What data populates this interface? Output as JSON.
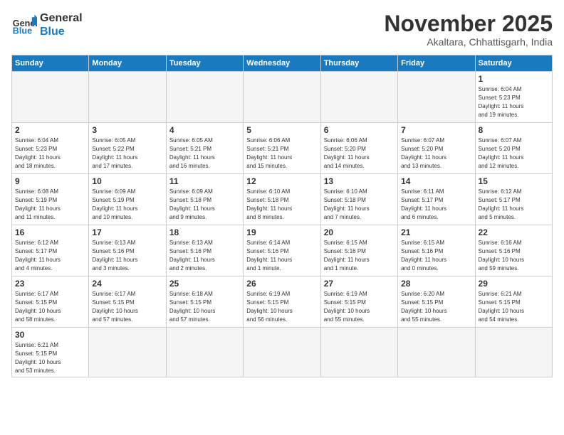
{
  "logo": {
    "text_general": "General",
    "text_blue": "Blue"
  },
  "title": "November 2025",
  "subtitle": "Akaltara, Chhattisgarh, India",
  "days_of_week": [
    "Sunday",
    "Monday",
    "Tuesday",
    "Wednesday",
    "Thursday",
    "Friday",
    "Saturday"
  ],
  "weeks": [
    [
      {
        "day": "",
        "info": ""
      },
      {
        "day": "",
        "info": ""
      },
      {
        "day": "",
        "info": ""
      },
      {
        "day": "",
        "info": ""
      },
      {
        "day": "",
        "info": ""
      },
      {
        "day": "",
        "info": ""
      },
      {
        "day": "1",
        "info": "Sunrise: 6:04 AM\nSunset: 5:23 PM\nDaylight: 11 hours\nand 19 minutes."
      }
    ],
    [
      {
        "day": "2",
        "info": "Sunrise: 6:04 AM\nSunset: 5:23 PM\nDaylight: 11 hours\nand 18 minutes."
      },
      {
        "day": "3",
        "info": "Sunrise: 6:05 AM\nSunset: 5:22 PM\nDaylight: 11 hours\nand 17 minutes."
      },
      {
        "day": "4",
        "info": "Sunrise: 6:05 AM\nSunset: 5:21 PM\nDaylight: 11 hours\nand 16 minutes."
      },
      {
        "day": "5",
        "info": "Sunrise: 6:06 AM\nSunset: 5:21 PM\nDaylight: 11 hours\nand 15 minutes."
      },
      {
        "day": "6",
        "info": "Sunrise: 6:06 AM\nSunset: 5:20 PM\nDaylight: 11 hours\nand 14 minutes."
      },
      {
        "day": "7",
        "info": "Sunrise: 6:07 AM\nSunset: 5:20 PM\nDaylight: 11 hours\nand 13 minutes."
      },
      {
        "day": "8",
        "info": "Sunrise: 6:07 AM\nSunset: 5:20 PM\nDaylight: 11 hours\nand 12 minutes."
      }
    ],
    [
      {
        "day": "9",
        "info": "Sunrise: 6:08 AM\nSunset: 5:19 PM\nDaylight: 11 hours\nand 11 minutes."
      },
      {
        "day": "10",
        "info": "Sunrise: 6:09 AM\nSunset: 5:19 PM\nDaylight: 11 hours\nand 10 minutes."
      },
      {
        "day": "11",
        "info": "Sunrise: 6:09 AM\nSunset: 5:18 PM\nDaylight: 11 hours\nand 9 minutes."
      },
      {
        "day": "12",
        "info": "Sunrise: 6:10 AM\nSunset: 5:18 PM\nDaylight: 11 hours\nand 8 minutes."
      },
      {
        "day": "13",
        "info": "Sunrise: 6:10 AM\nSunset: 5:18 PM\nDaylight: 11 hours\nand 7 minutes."
      },
      {
        "day": "14",
        "info": "Sunrise: 6:11 AM\nSunset: 5:17 PM\nDaylight: 11 hours\nand 6 minutes."
      },
      {
        "day": "15",
        "info": "Sunrise: 6:12 AM\nSunset: 5:17 PM\nDaylight: 11 hours\nand 5 minutes."
      }
    ],
    [
      {
        "day": "16",
        "info": "Sunrise: 6:12 AM\nSunset: 5:17 PM\nDaylight: 11 hours\nand 4 minutes."
      },
      {
        "day": "17",
        "info": "Sunrise: 6:13 AM\nSunset: 5:16 PM\nDaylight: 11 hours\nand 3 minutes."
      },
      {
        "day": "18",
        "info": "Sunrise: 6:13 AM\nSunset: 5:16 PM\nDaylight: 11 hours\nand 2 minutes."
      },
      {
        "day": "19",
        "info": "Sunrise: 6:14 AM\nSunset: 5:16 PM\nDaylight: 11 hours\nand 1 minute."
      },
      {
        "day": "20",
        "info": "Sunrise: 6:15 AM\nSunset: 5:16 PM\nDaylight: 11 hours\nand 1 minute."
      },
      {
        "day": "21",
        "info": "Sunrise: 6:15 AM\nSunset: 5:16 PM\nDaylight: 11 hours\nand 0 minutes."
      },
      {
        "day": "22",
        "info": "Sunrise: 6:16 AM\nSunset: 5:16 PM\nDaylight: 10 hours\nand 59 minutes."
      }
    ],
    [
      {
        "day": "23",
        "info": "Sunrise: 6:17 AM\nSunset: 5:15 PM\nDaylight: 10 hours\nand 58 minutes."
      },
      {
        "day": "24",
        "info": "Sunrise: 6:17 AM\nSunset: 5:15 PM\nDaylight: 10 hours\nand 57 minutes."
      },
      {
        "day": "25",
        "info": "Sunrise: 6:18 AM\nSunset: 5:15 PM\nDaylight: 10 hours\nand 57 minutes."
      },
      {
        "day": "26",
        "info": "Sunrise: 6:19 AM\nSunset: 5:15 PM\nDaylight: 10 hours\nand 56 minutes."
      },
      {
        "day": "27",
        "info": "Sunrise: 6:19 AM\nSunset: 5:15 PM\nDaylight: 10 hours\nand 55 minutes."
      },
      {
        "day": "28",
        "info": "Sunrise: 6:20 AM\nSunset: 5:15 PM\nDaylight: 10 hours\nand 55 minutes."
      },
      {
        "day": "29",
        "info": "Sunrise: 6:21 AM\nSunset: 5:15 PM\nDaylight: 10 hours\nand 54 minutes."
      }
    ],
    [
      {
        "day": "30",
        "info": "Sunrise: 6:21 AM\nSunset: 5:15 PM\nDaylight: 10 hours\nand 53 minutes."
      },
      {
        "day": "",
        "info": ""
      },
      {
        "day": "",
        "info": ""
      },
      {
        "day": "",
        "info": ""
      },
      {
        "day": "",
        "info": ""
      },
      {
        "day": "",
        "info": ""
      },
      {
        "day": "",
        "info": ""
      }
    ]
  ]
}
